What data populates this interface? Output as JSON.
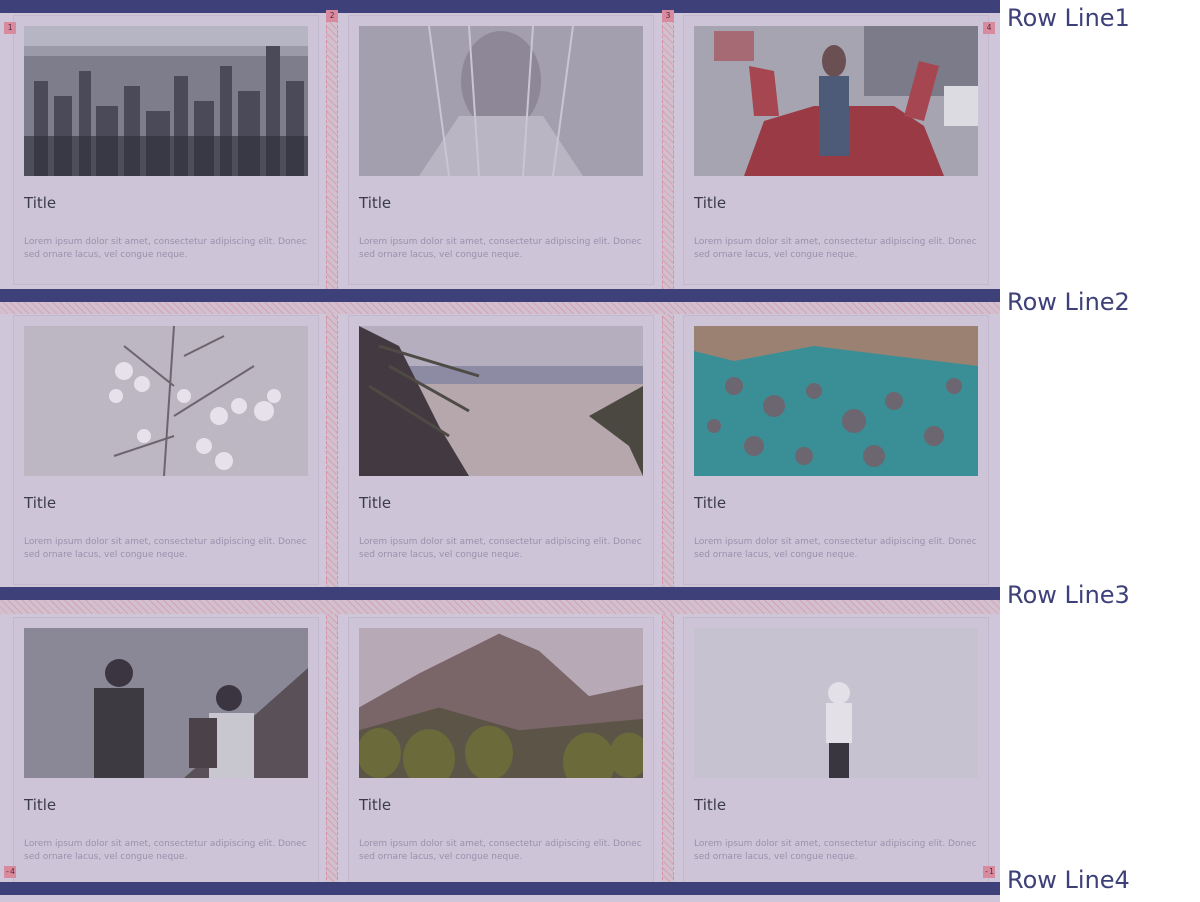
{
  "row_labels": [
    "Row Line1",
    "Row Line2",
    "Row Line3",
    "Row Line4"
  ],
  "line_numbers": {
    "top": [
      "1",
      "2",
      "3",
      "4"
    ],
    "bottom_left": "-4",
    "bottom_right": "-1"
  },
  "cards": [
    {
      "title": "Title",
      "text": "Lorem ipsum dolor sit amet, consectetur adipiscing elit. Donec sed ornare lacus, vel congue neque.",
      "image": "city-skyline-photo"
    },
    {
      "title": "Title",
      "text": "Lorem ipsum dolor sit amet, consectetur adipiscing elit. Donec sed ornare lacus, vel congue neque.",
      "image": "veiled-woman-photo"
    },
    {
      "title": "Title",
      "text": "Lorem ipsum dolor sit amet, consectetur adipiscing elit. Donec sed ornare lacus, vel congue neque.",
      "image": "woman-red-sports-car-photo"
    },
    {
      "title": "Title",
      "text": "Lorem ipsum dolor sit amet, consectetur adipiscing elit. Donec sed ornare lacus, vel congue neque.",
      "image": "white-blossom-branches-photo"
    },
    {
      "title": "Title",
      "text": "Lorem ipsum dolor sit amet, consectetur adipiscing elit. Donec sed ornare lacus, vel congue neque.",
      "image": "beach-palm-leaves-photo"
    },
    {
      "title": "Title",
      "text": "Lorem ipsum dolor sit amet, consectetur adipiscing elit. Donec sed ornare lacus, vel congue neque.",
      "image": "aerial-rocky-coast-photo"
    },
    {
      "title": "Title",
      "text": "Lorem ipsum dolor sit amet, consectetur adipiscing elit. Donec sed ornare lacus, vel congue neque.",
      "image": "two-men-backpacks-photo"
    },
    {
      "title": "Title",
      "text": "Lorem ipsum dolor sit amet, consectetur adipiscing elit. Donec sed ornare lacus, vel congue neque.",
      "image": "foggy-mountain-photo"
    },
    {
      "title": "Title",
      "text": "Lorem ipsum dolor sit amet, consectetur adipiscing elit. Donec sed ornare lacus, vel congue neque.",
      "image": "person-white-hoodie-photo"
    }
  ],
  "colors": {
    "row_line": "#3d4079",
    "grid_overlay": "#cfc6d9",
    "gap_hatch": "#d890a8",
    "line_number_badge": "#d88a9e"
  }
}
